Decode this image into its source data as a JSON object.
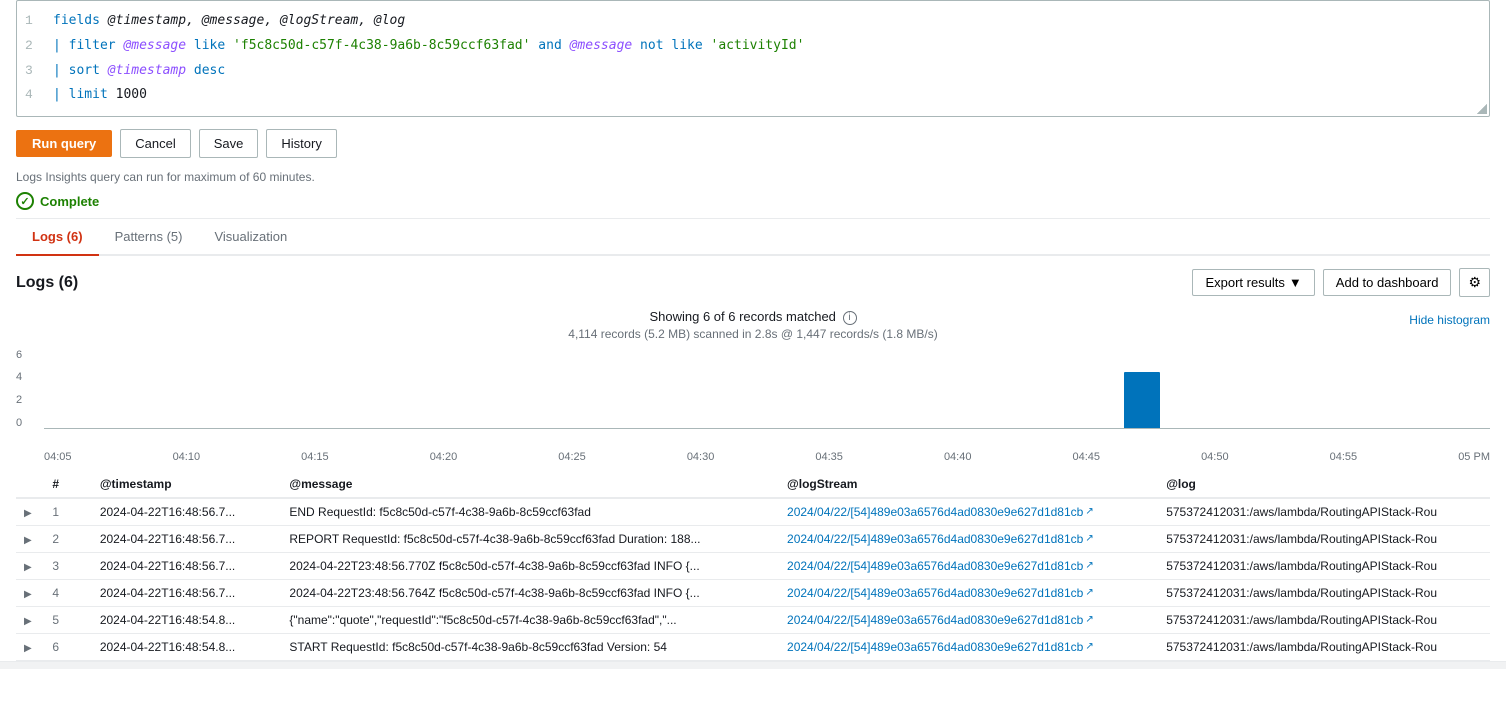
{
  "query": {
    "lines": [
      {
        "num": 1,
        "parts": [
          {
            "text": "fields ",
            "class": "kw-blue"
          },
          {
            "text": "@timestamp, @message, @logStream, @log",
            "class": "kw-italic"
          }
        ]
      },
      {
        "num": 2,
        "parts": [
          {
            "text": "| filter ",
            "class": "kw-blue"
          },
          {
            "text": "@message",
            "class": "kw-italic kw-purple"
          },
          {
            "text": " like ",
            "class": "kw-blue"
          },
          {
            "text": "'f5c8c50d-c57f-4c38-9a6b-8c59ccf63fad'",
            "class": "kw-string"
          },
          {
            "text": " and ",
            "class": "kw-blue"
          },
          {
            "text": "@message",
            "class": "kw-italic kw-purple"
          },
          {
            "text": " not like ",
            "class": "kw-blue"
          },
          {
            "text": "'activityId'",
            "class": "kw-string"
          }
        ]
      },
      {
        "num": 3,
        "parts": [
          {
            "text": "| sort ",
            "class": "kw-blue"
          },
          {
            "text": "@timestamp",
            "class": "kw-italic kw-purple"
          },
          {
            "text": " desc",
            "class": "kw-blue"
          }
        ]
      },
      {
        "num": 4,
        "parts": [
          {
            "text": "| limit ",
            "class": "kw-blue"
          },
          {
            "text": "1000",
            "class": ""
          }
        ]
      }
    ]
  },
  "toolbar": {
    "run_label": "Run query",
    "cancel_label": "Cancel",
    "save_label": "Save",
    "history_label": "History"
  },
  "query_note": "Logs Insights query can run for maximum of 60 minutes.",
  "status": {
    "label": "Complete"
  },
  "tabs": [
    {
      "id": "logs",
      "label": "Logs (6)",
      "active": true
    },
    {
      "id": "patterns",
      "label": "Patterns (5)",
      "active": false
    },
    {
      "id": "visualization",
      "label": "Visualization",
      "active": false
    }
  ],
  "results": {
    "title": "Logs (6)",
    "export_label": "Export results",
    "dashboard_label": "Add to dashboard",
    "histogram": {
      "showing_text": "Showing 6 of 6 records matched",
      "scan_text": "4,114 records (5.2 MB) scanned in 2.8s @ 1,447 records/s (1.8 MB/s)",
      "hide_label": "Hide histogram",
      "x_labels": [
        "04:05",
        "04:10",
        "04:15",
        "04:20",
        "04:25",
        "04:30",
        "04:35",
        "04:40",
        "04:45",
        "04:50",
        "04:55",
        "05 PM"
      ],
      "y_labels": [
        "6",
        "4",
        "2",
        "0"
      ],
      "bars": [
        {
          "x_pct": 0,
          "height_pct": 0
        },
        {
          "x_pct": 8.3,
          "height_pct": 0
        },
        {
          "x_pct": 16.6,
          "height_pct": 0
        },
        {
          "x_pct": 24.9,
          "height_pct": 0
        },
        {
          "x_pct": 33.2,
          "height_pct": 0
        },
        {
          "x_pct": 41.5,
          "height_pct": 0
        },
        {
          "x_pct": 49.8,
          "height_pct": 0
        },
        {
          "x_pct": 58.1,
          "height_pct": 0
        },
        {
          "x_pct": 66.4,
          "height_pct": 0
        },
        {
          "x_pct": 74.7,
          "height_pct": 100
        },
        {
          "x_pct": 83.0,
          "height_pct": 0
        },
        {
          "x_pct": 91.3,
          "height_pct": 0
        }
      ]
    },
    "table": {
      "columns": [
        "#",
        "@timestamp",
        "@message",
        "@logStream",
        "@log"
      ],
      "rows": [
        {
          "num": 1,
          "timestamp": "2024-04-22T16:48:56.7...",
          "message": "END RequestId: f5c8c50d-c57f-4c38-9a6b-8c59ccf63fad",
          "logstream": "2024/04/22/[54]489e03a6576d4ad0830e9e627d1d81cb",
          "log": "575372412031:/aws/lambda/RoutingAPIStack-Rou"
        },
        {
          "num": 2,
          "timestamp": "2024-04-22T16:48:56.7...",
          "message": "REPORT RequestId: f5c8c50d-c57f-4c38-9a6b-8c59ccf63fad Duration: 188...",
          "logstream": "2024/04/22/[54]489e03a6576d4ad0830e9e627d1d81cb",
          "log": "575372412031:/aws/lambda/RoutingAPIStack-Rou"
        },
        {
          "num": 3,
          "timestamp": "2024-04-22T16:48:56.7...",
          "message": "2024-04-22T23:48:56.770Z f5c8c50d-c57f-4c38-9a6b-8c59ccf63fad INFO {...",
          "logstream": "2024/04/22/[54]489e03a6576d4ad0830e9e627d1d81cb",
          "log": "575372412031:/aws/lambda/RoutingAPIStack-Rou"
        },
        {
          "num": 4,
          "timestamp": "2024-04-22T16:48:56.7...",
          "message": "2024-04-22T23:48:56.764Z f5c8c50d-c57f-4c38-9a6b-8c59ccf63fad INFO {...",
          "logstream": "2024/04/22/[54]489e03a6576d4ad0830e9e627d1d81cb",
          "log": "575372412031:/aws/lambda/RoutingAPIStack-Rou"
        },
        {
          "num": 5,
          "timestamp": "2024-04-22T16:48:54.8...",
          "message": "{\"name\":\"quote\",\"requestId\":\"f5c8c50d-c57f-4c38-9a6b-8c59ccf63fad\",\"...",
          "logstream": "2024/04/22/[54]489e03a6576d4ad0830e9e627d1d81cb",
          "log": "575372412031:/aws/lambda/RoutingAPIStack-Rou"
        },
        {
          "num": 6,
          "timestamp": "2024-04-22T16:48:54.8...",
          "message": "START RequestId: f5c8c50d-c57f-4c38-9a6b-8c59ccf63fad Version: 54",
          "logstream": "2024/04/22/[54]489e03a6576d4ad0830e9e627d1d81cb",
          "log": "575372412031:/aws/lambda/RoutingAPIStack-Rou"
        }
      ]
    }
  }
}
